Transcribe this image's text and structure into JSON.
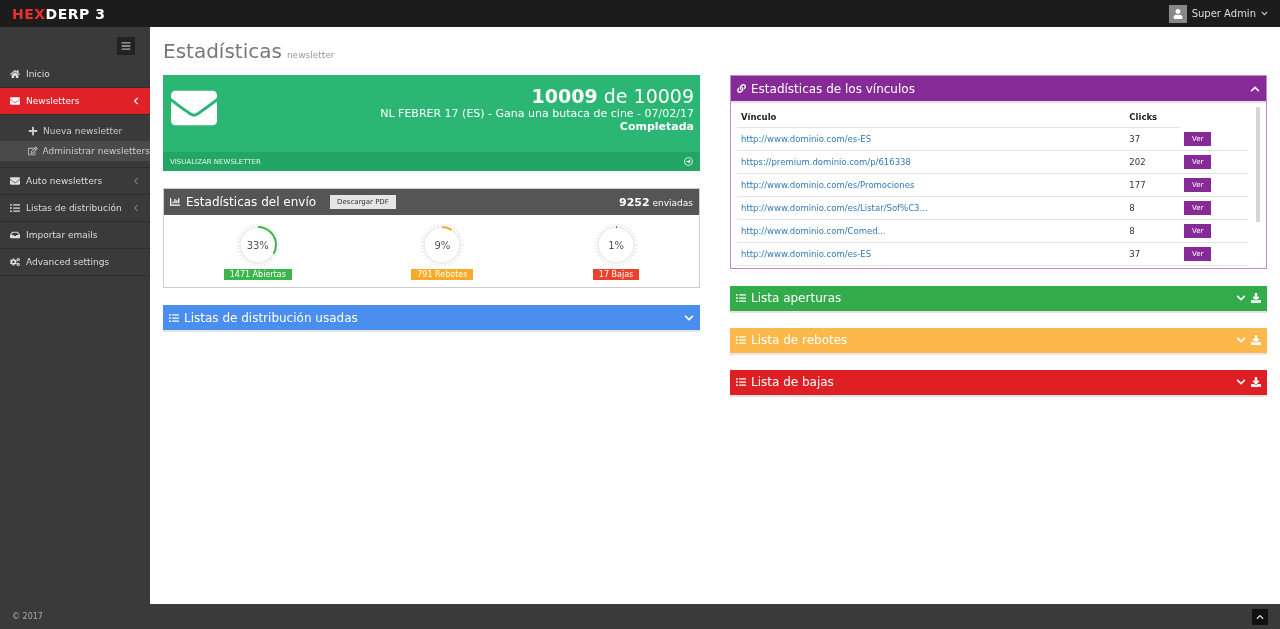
{
  "topbar": {
    "logo_accent": "HEX",
    "logo_rest": "DERP 3",
    "user": "Super Admin"
  },
  "sidebar": {
    "items": [
      {
        "label": "Inicio",
        "selected": false
      },
      {
        "label": "Newsletters",
        "selected": true,
        "expanded": true,
        "children": [
          {
            "label": "Nueva newsletter",
            "selected": false
          },
          {
            "label": "Administrar newsletters",
            "selected": true
          }
        ]
      },
      {
        "label": "Auto newsletters",
        "selected": false,
        "expanded": false
      },
      {
        "label": "Listas de distribución",
        "selected": false,
        "expanded": false
      },
      {
        "label": "Importar emails",
        "selected": false
      },
      {
        "label": "Advanced settings",
        "selected": false
      }
    ]
  },
  "page": {
    "title": "Estadísticas",
    "subtitle": "newsletter"
  },
  "summary": {
    "sent": "10009",
    "of_label": "de 10009",
    "name": "NL FEBRER 17 (ES) - Gana una butaca de cine - 07/02/17",
    "status": "Completada",
    "link": "VISUALIZAR NEWSLETTER"
  },
  "send_stats": {
    "title": "Estadísticas del envío",
    "button": "Descargar PDF",
    "count": "9252",
    "count_label": "enviadas",
    "gauges": [
      {
        "percent": "33%",
        "level": 0.33,
        "label": "1471 Abiertas",
        "color": "#3cb64a"
      },
      {
        "percent": "9%",
        "level": 0.09,
        "label": "791 Rebotes",
        "color": "#f8ab29"
      },
      {
        "percent": "1%",
        "level": 0.01,
        "label": "17 Bajas",
        "color": "#e8412c"
      }
    ]
  },
  "left_panels": [
    {
      "title": "Listas de distribución usadas",
      "color": "#4a8ef0",
      "expanded": false,
      "download": false
    }
  ],
  "links_panel": {
    "title": "Estadísticas de los vínculos",
    "color": "#852a96",
    "expanded": true,
    "columns": [
      "Vínculo",
      "Clicks"
    ],
    "rows": [
      {
        "url": "http://www.dominio.com/es-ES",
        "clicks": "37",
        "button": "Ver"
      },
      {
        "url": "https://premium.dominio.com/p/616338",
        "clicks": "202",
        "button": "Ver"
      },
      {
        "url": "http://www.dominio.com/es/Promociones",
        "clicks": "177",
        "button": "Ver"
      },
      {
        "url": "http://www.dominio.com/es/Listar/Sof%C3...",
        "clicks": "8",
        "button": "Ver"
      },
      {
        "url": "http://www.dominio.com/Comed...",
        "clicks": "8",
        "button": "Ver"
      },
      {
        "url": "http://www.dominio.com/es-ES",
        "clicks": "37",
        "button": "Ver"
      }
    ]
  },
  "right_panels": [
    {
      "title": "Lista aperturas",
      "color": "#34ab4a",
      "expanded": false,
      "download": true
    },
    {
      "title": "Lista de rebotes",
      "color": "#fdb84b",
      "expanded": false,
      "download": true
    },
    {
      "title": "Lista de bajas",
      "color": "#de2025",
      "expanded": false,
      "download": true
    }
  ],
  "footer": {
    "copyright": "© 2017"
  }
}
